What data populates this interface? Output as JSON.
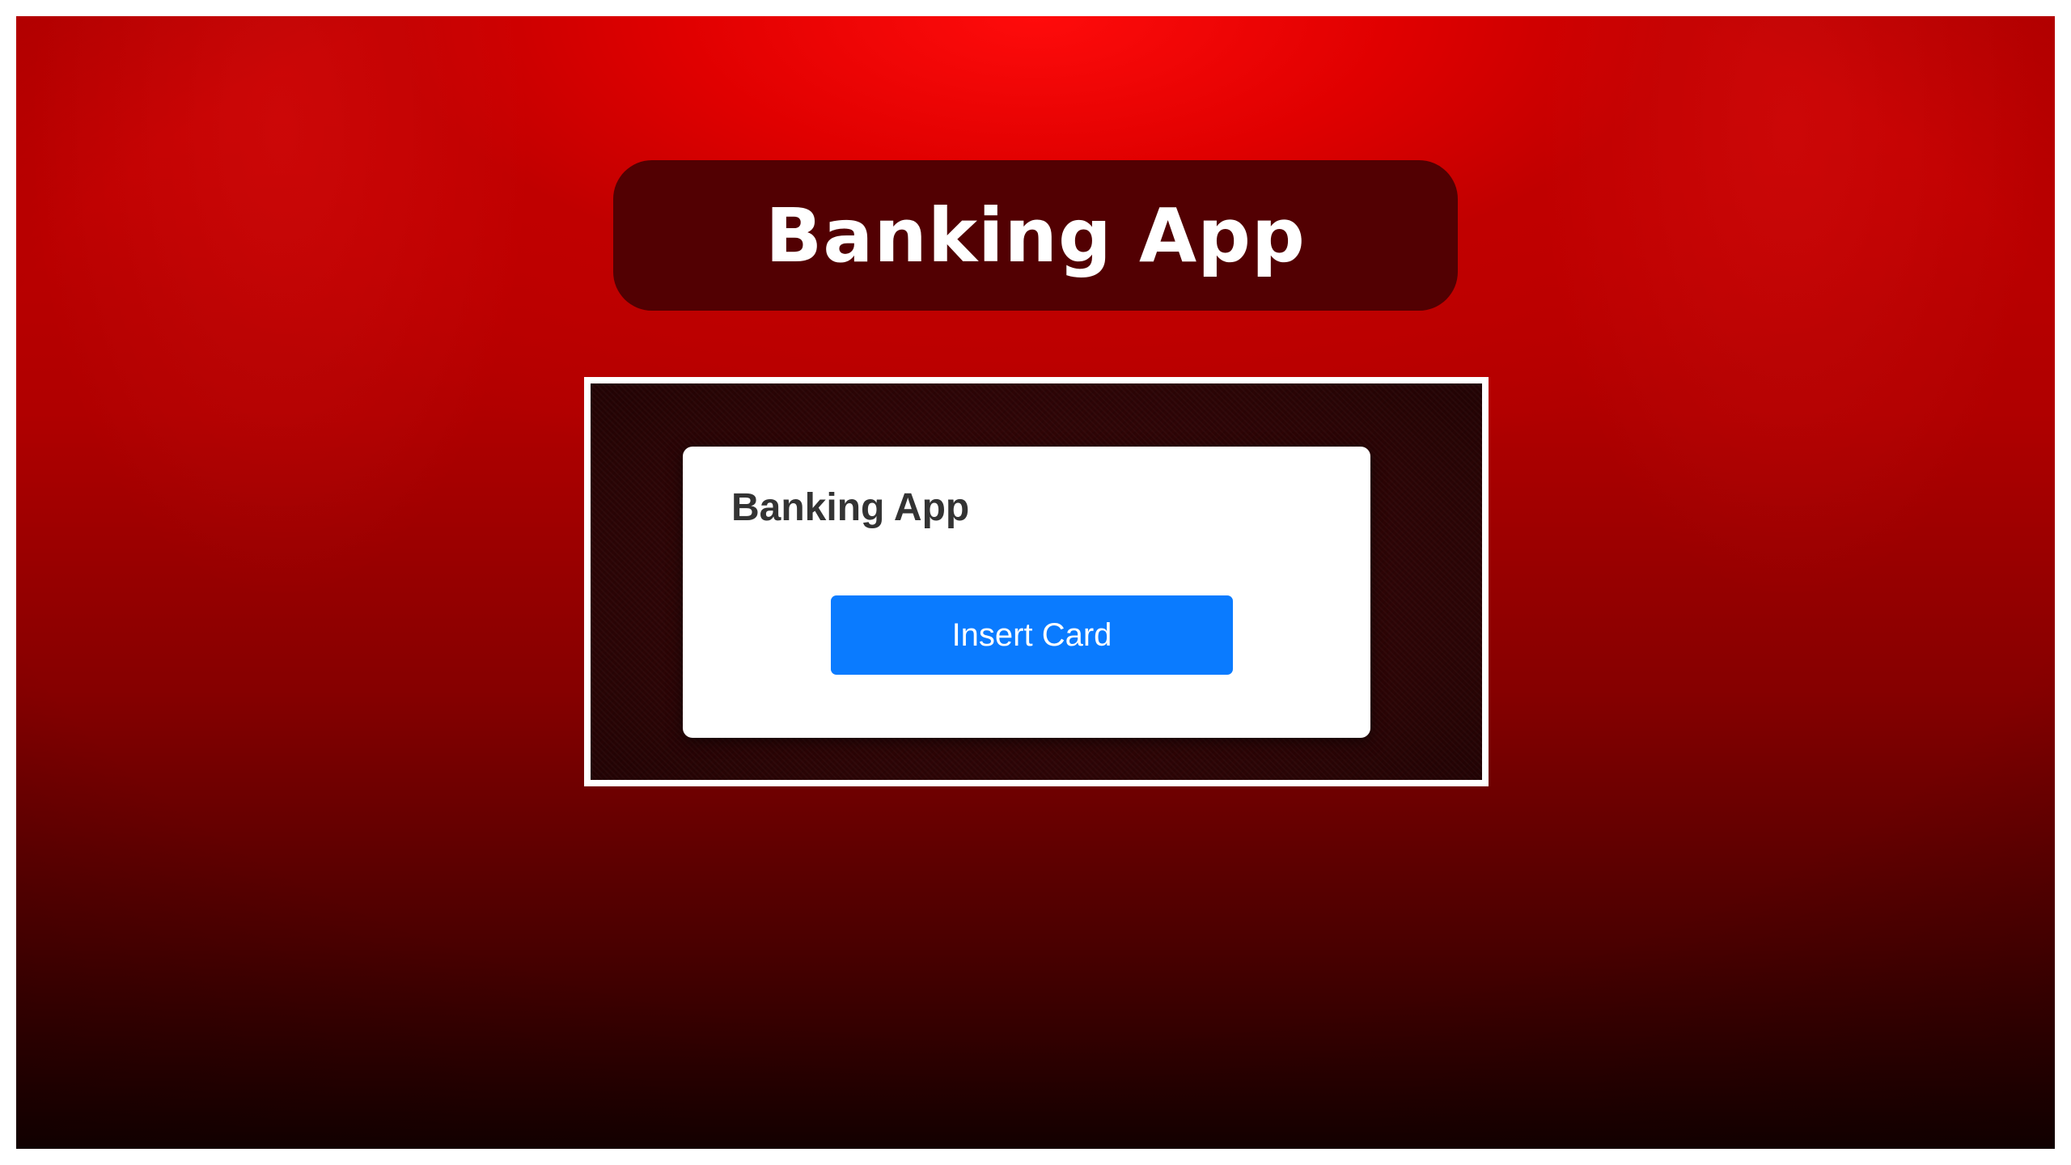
{
  "header": {
    "title": "Banking App"
  },
  "app": {
    "title": "Banking App",
    "insert_card_label": "Insert Card"
  },
  "colors": {
    "background_red": "#c80000",
    "title_pill": "#520002",
    "frame_border": "#ffffff",
    "button_blue": "#0a7bff",
    "card_background": "#ffffff"
  }
}
